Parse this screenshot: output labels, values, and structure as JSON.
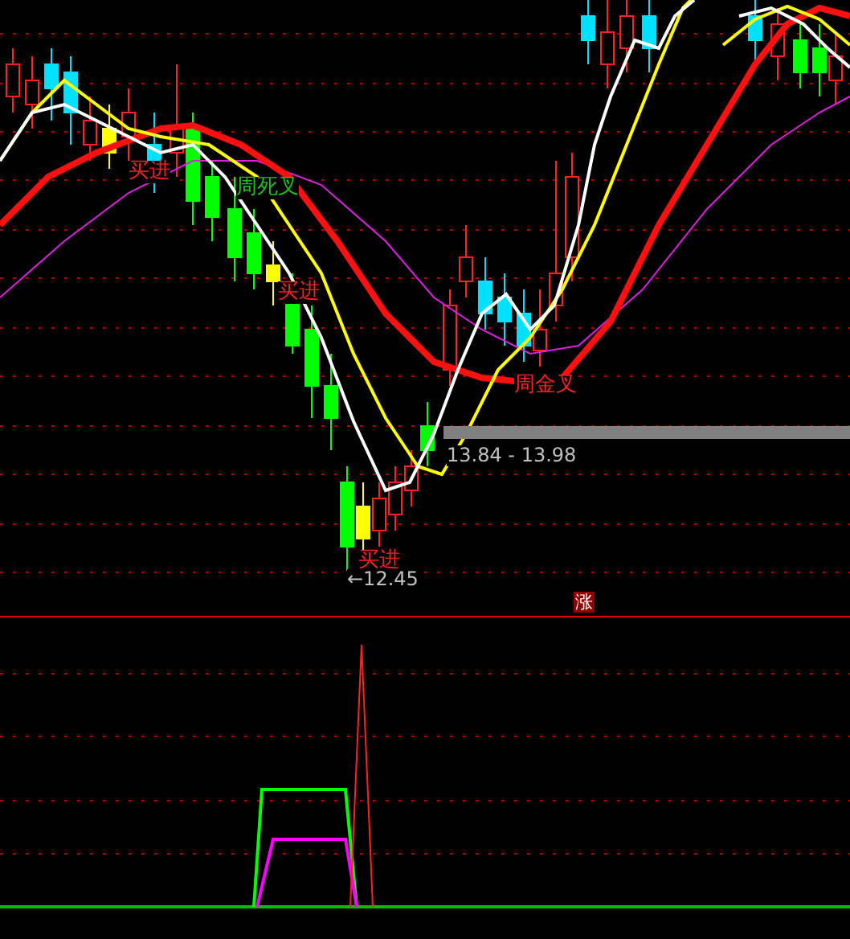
{
  "signals": [
    {
      "text": "买进",
      "color": "#ff2020"
    },
    {
      "text": "周死叉",
      "color": "#20c020"
    },
    {
      "text": "买进",
      "color": "#ff2020"
    },
    {
      "text": "周金叉",
      "color": "#ff2020"
    },
    {
      "text": "买进",
      "color": "#ff2020"
    }
  ],
  "price_range": "13.84 - 13.98",
  "low_marker": "←12.45",
  "badge": "涨"
}
